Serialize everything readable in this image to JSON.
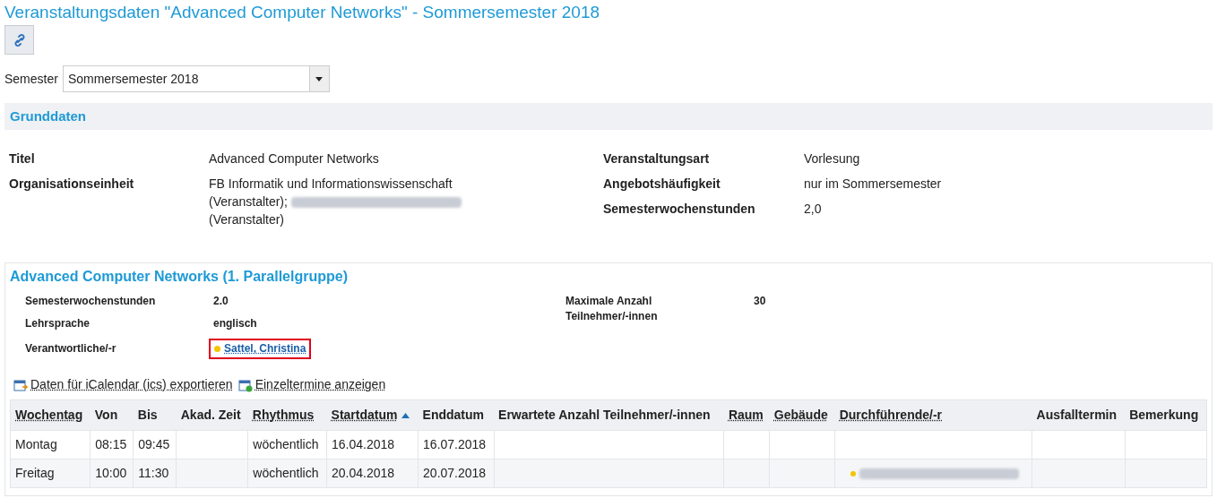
{
  "title": "Veranstaltungsdaten \"Advanced Computer Networks\" - Sommersemester 2018",
  "semester": {
    "label": "Semester",
    "value": "Sommersemester 2018"
  },
  "basic": {
    "heading": "Grunddaten",
    "left": [
      {
        "label": "Titel",
        "parts": [
          {
            "kind": "text",
            "text": "Advanced Computer Networks"
          }
        ]
      },
      {
        "label": "Organisationseinheit",
        "parts": [
          {
            "kind": "text",
            "text": "FB Informatik und Informationswissenschaft"
          },
          {
            "kind": "text",
            "text": "(Veranstalter);"
          },
          {
            "kind": "redacted"
          },
          {
            "kind": "break"
          },
          {
            "kind": "text",
            "text": "(Veranstalter)"
          }
        ]
      }
    ],
    "right": [
      {
        "label": "Veranstaltungsart",
        "value": "Vorlesung"
      },
      {
        "label": "Angebotshäufigkeit",
        "value": "nur im Sommersemester"
      },
      {
        "label": "Semesterwochenstunden",
        "value": "2,0"
      }
    ]
  },
  "group": {
    "heading": "Advanced Computer Networks (1. Parallelgruppe)",
    "left": [
      {
        "label": "Semesterwochenstunden",
        "value": "2.0",
        "kind": "text"
      },
      {
        "label": "Lehrsprache",
        "value": "englisch",
        "kind": "text"
      },
      {
        "label": "Verantwortliche/-r",
        "value": "Sattel, Christina",
        "kind": "person",
        "color": "#f5c400",
        "highlighted": true
      }
    ],
    "right": [
      {
        "label": "Maximale Anzahl Teilnehmer/-innen",
        "value": "30"
      }
    ],
    "actions": [
      {
        "label": "Daten für iCalendar (ics) exportieren",
        "kind": "export"
      },
      {
        "label": "Einzeltermine anzeigen",
        "kind": "add"
      }
    ],
    "table": {
      "columns": [
        {
          "label": "Wochentag",
          "sortable": true,
          "sorted": false
        },
        {
          "label": "Von",
          "sortable": false,
          "sorted": false
        },
        {
          "label": "Bis",
          "sortable": false,
          "sorted": false
        },
        {
          "label": "Akad. Zeit",
          "sortable": false,
          "sorted": false
        },
        {
          "label": "Rhythmus",
          "sortable": true,
          "sorted": false
        },
        {
          "label": "Startdatum",
          "sortable": true,
          "sorted": true
        },
        {
          "label": "Enddatum",
          "sortable": false,
          "sorted": false
        },
        {
          "label": "Erwartete Anzahl Teilnehmer/-innen",
          "sortable": false,
          "sorted": false
        },
        {
          "label": "Raum",
          "sortable": true,
          "sorted": false
        },
        {
          "label": "Gebäude",
          "sortable": true,
          "sorted": false
        },
        {
          "label": "Durchführende/-r",
          "sortable": true,
          "sorted": false
        },
        {
          "label": "Ausfalltermin",
          "sortable": false,
          "sorted": false
        },
        {
          "label": "Bemerkung",
          "sortable": false,
          "sorted": false
        }
      ],
      "rows": [
        {
          "cells": [
            "Montag",
            "08:15",
            "09:45",
            "",
            "wöchentlich",
            "16.04.2018",
            "16.07.2018",
            "",
            "",
            "",
            "",
            "",
            ""
          ],
          "performer_redacted": false
        },
        {
          "cells": [
            "Freitag",
            "10:00",
            "11:30",
            "",
            "wöchentlich",
            "20.04.2018",
            "20.07.2018",
            "",
            "",
            "",
            "",
            "",
            ""
          ],
          "performer_redacted": true,
          "color": "#f5c400"
        }
      ]
    }
  }
}
